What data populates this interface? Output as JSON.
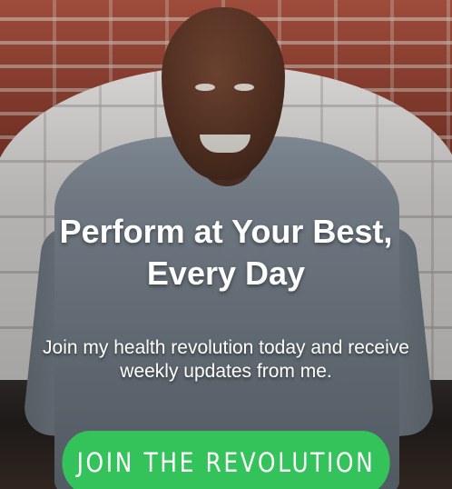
{
  "hero": {
    "headline": "Perform at Your Best, Every Day",
    "subtext": "Join my health revolution today and receive weekly updates from me."
  },
  "cta": {
    "label": "JOIN THE REVOLUTION",
    "color": "#33c35a"
  }
}
